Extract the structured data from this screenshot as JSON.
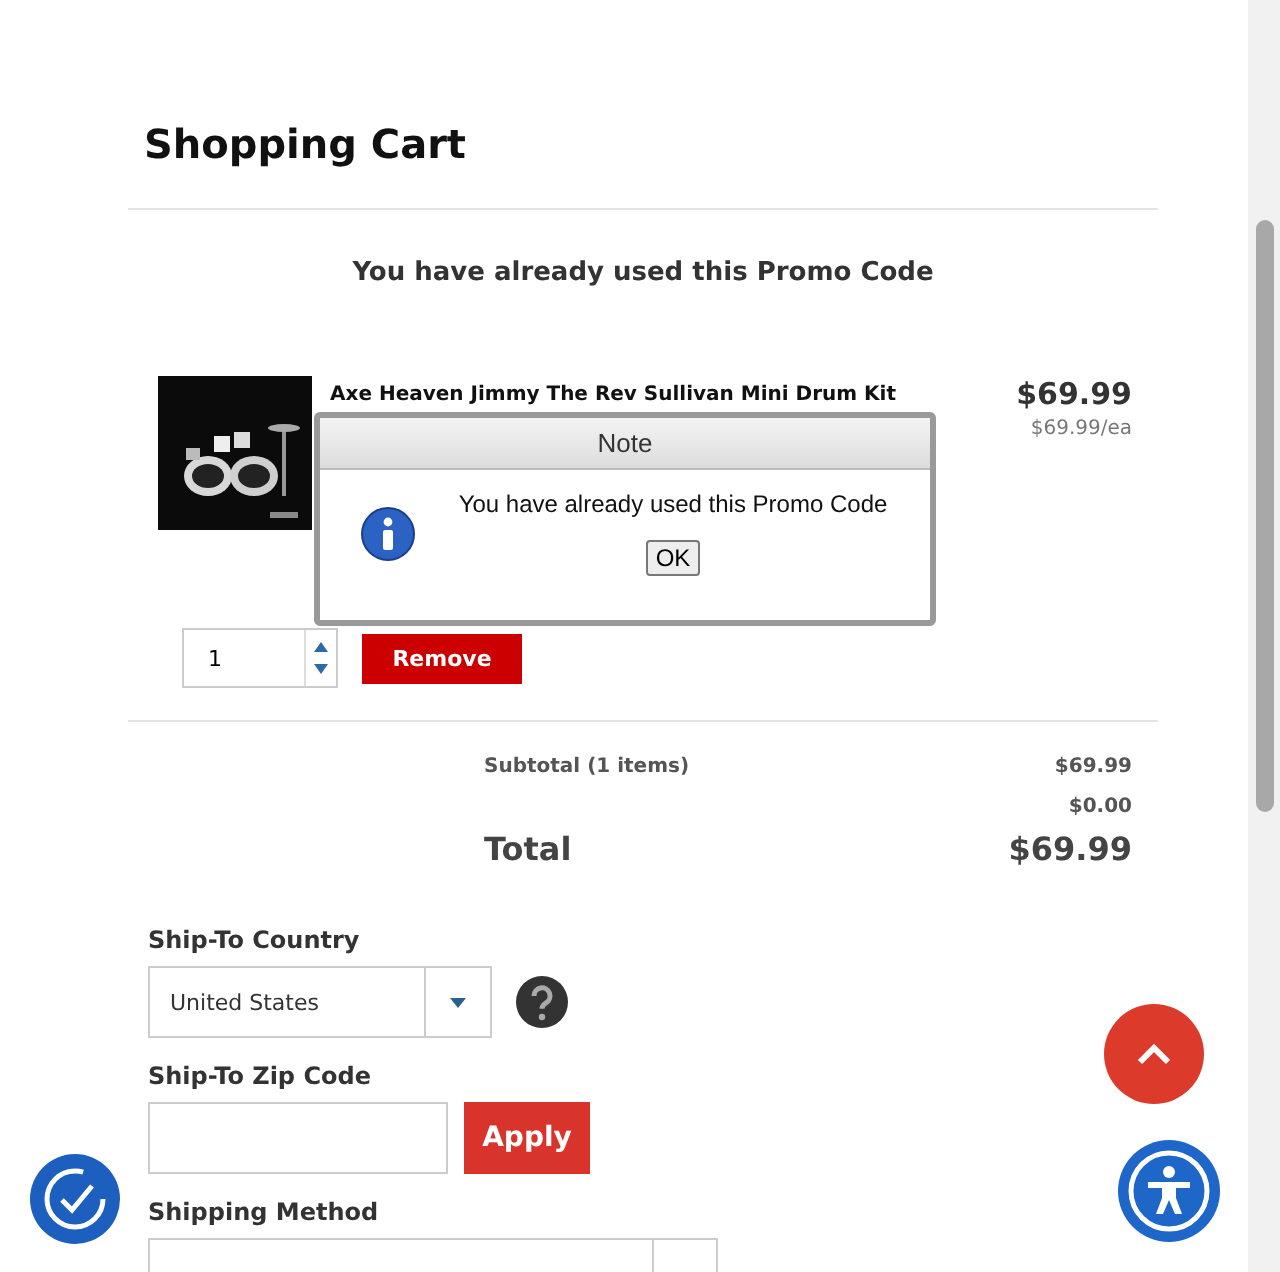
{
  "page_title": "Shopping Cart",
  "promo_message": "You have already used this Promo Code",
  "items": [
    {
      "name": "Axe Heaven Jimmy The Rev Sullivan Mini Drum Kit",
      "price": "$69.99",
      "unit_price": "$69.99/ea",
      "quantity": "1",
      "remove_label": "Remove"
    }
  ],
  "summary": [
    {
      "kind": "subtotal",
      "label": "Subtotal (1 items)",
      "value": "$69.99"
    },
    {
      "kind": "line",
      "value": "$0.00"
    },
    {
      "kind": "total",
      "label": "Total",
      "value": "$69.99"
    }
  ],
  "ship_country": {
    "label": "Ship-To Country",
    "value": "United States"
  },
  "ship_zip": {
    "label": "Ship-To Zip Code",
    "button": "Apply"
  },
  "shipping_method": {
    "label": "Shipping Method"
  },
  "dialog": {
    "title": "Note",
    "message": "You have already used this Promo Code",
    "button": "OK"
  }
}
